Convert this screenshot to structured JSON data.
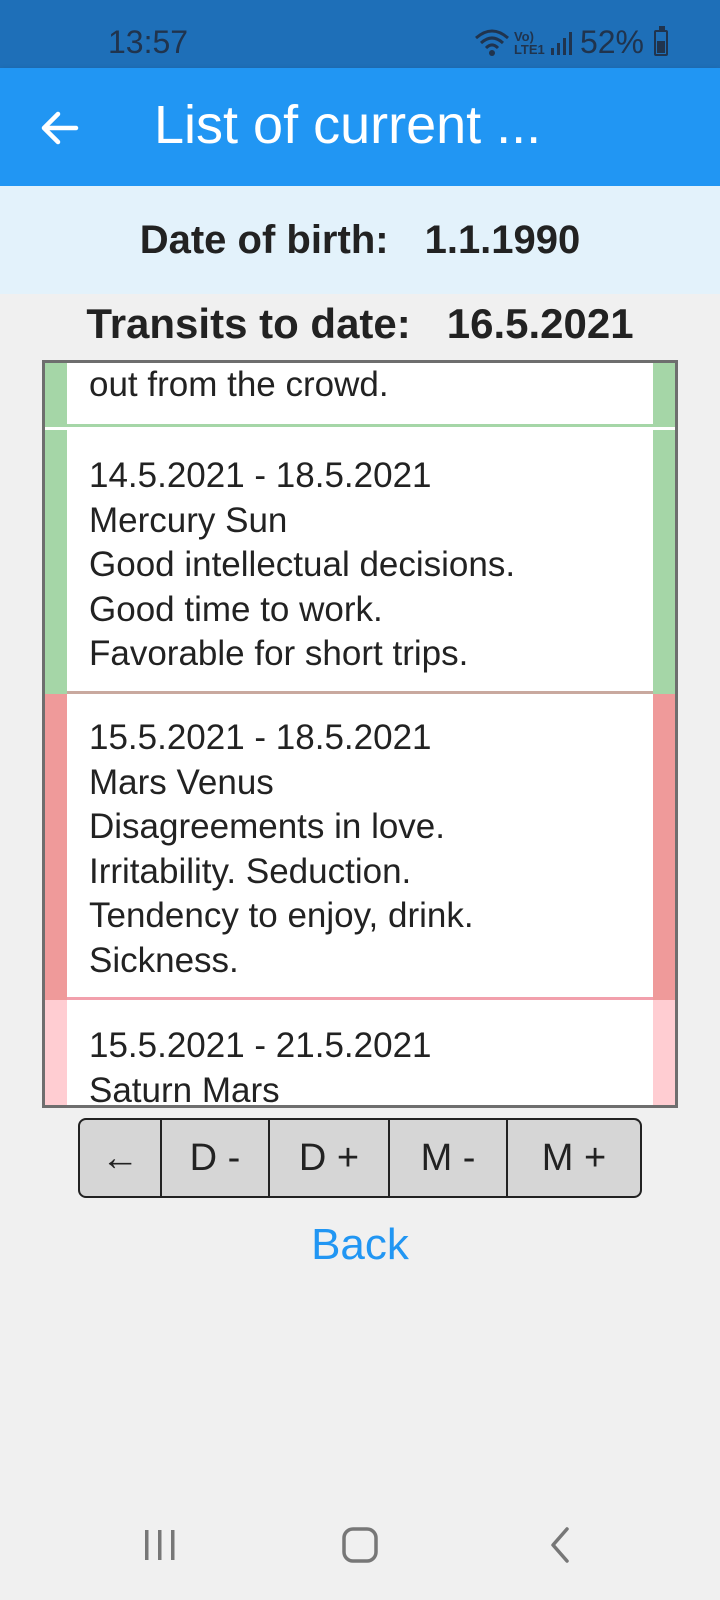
{
  "status_bar": {
    "time": "13:57",
    "battery": "52%",
    "network": "Vo) LTE1"
  },
  "app_bar": {
    "title": "List of current ..."
  },
  "birth": {
    "label": "Date of birth:",
    "value": "1.1.1990"
  },
  "transits": {
    "label": "Transits to date:",
    "value": "16.5.2021"
  },
  "colors": {
    "favorable": "#a5d6a7",
    "unfavorable": "#ef9a9a",
    "mild_unfavorable": "#ffcdd2",
    "accent": "#2196f3"
  },
  "transit_list": [
    {
      "lines": [
        "out from the crowd."
      ],
      "tone": "favorable"
    },
    {
      "lines": [
        "14.5.2021 - 18.5.2021",
        "Mercury Sun",
        "Good intellectual decisions.",
        "Good time to work.",
        "Favorable for short trips."
      ],
      "tone": "favorable"
    },
    {
      "lines": [
        "15.5.2021 - 18.5.2021",
        "Mars Venus",
        "Disagreements in love.",
        "Irritability. Seduction.",
        "Tendency to enjoy, drink.",
        "Sickness."
      ],
      "tone": "unfavorable"
    },
    {
      "lines": [
        "15.5.2021 - 21.5.2021",
        "Saturn Mars"
      ],
      "tone": "mild_unfavorable"
    }
  ],
  "controls": {
    "prev": "←",
    "day_minus": "D -",
    "day_plus": "D +",
    "month_minus": "M -",
    "month_plus": "M +"
  },
  "back_label": "Back",
  "nav": {
    "recents": "recents-icon",
    "home": "home-icon",
    "back": "back-icon"
  }
}
